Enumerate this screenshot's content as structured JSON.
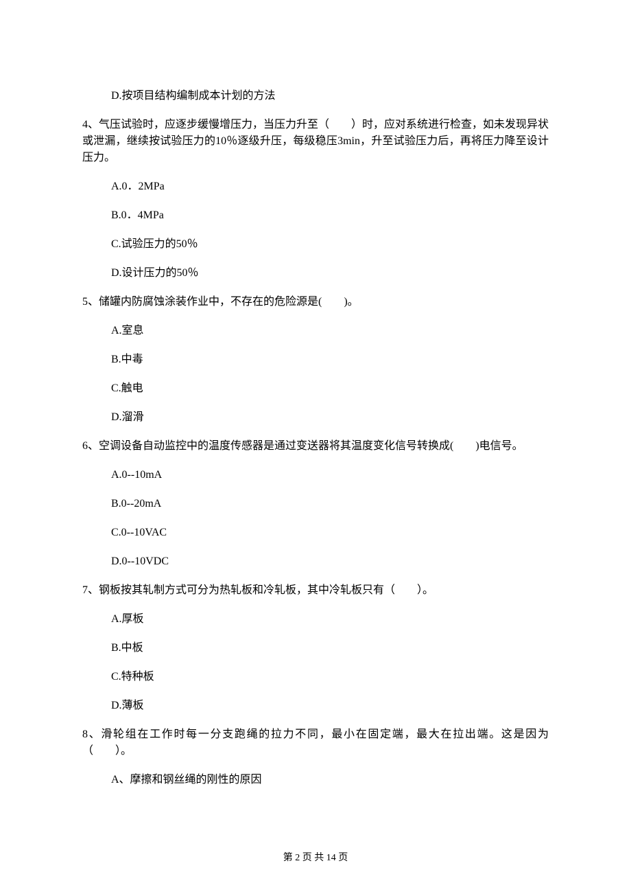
{
  "q3": {
    "options": {
      "D": "D.按项目结构编制成本计划的方法"
    }
  },
  "q4": {
    "stem": "4、气压试验时，应逐步缓慢增压力，当压力升至（　　）时，应对系统进行检查，如未发现异状或泄漏，继续按试验压力的10％逐级升压，每级稳压3min，升至试验压力后，再将压力降至设计压力。",
    "options": {
      "A": "A.0．2MPa",
      "B": "B.0．4MPa",
      "C": "C.试验压力的50％",
      "D": "D.设计压力的50％"
    }
  },
  "q5": {
    "stem": "5、储罐内防腐蚀涂装作业中，不存在的危险源是(　　)。",
    "options": {
      "A": "A.室息",
      "B": "B.中毒",
      "C": "C.触电",
      "D": "D.溜滑"
    }
  },
  "q6": {
    "stem": "6、空调设备自动监控中的温度传感器是通过变送器将其温度变化信号转换成(　　)电信号。",
    "options": {
      "A": "A.0--10mA",
      "B": "B.0--20mA",
      "C": "C.0--10VAC",
      "D": "D.0--10VDC"
    }
  },
  "q7": {
    "stem": "7、钢板按其轧制方式可分为热轧板和冷轧板，其中冷轧板只有（　　）。",
    "options": {
      "A": "A.厚板",
      "B": "B.中板",
      "C": "C.特种板",
      "D": "D.薄板"
    }
  },
  "q8": {
    "stem": "8、滑轮组在工作时每一分支跑绳的拉力不同，最小在固定端，最大在拉出端。这是因为（　　）。",
    "options": {
      "A": "A、摩擦和钢丝绳的刚性的原因"
    }
  },
  "footer": "第 2 页 共 14 页"
}
